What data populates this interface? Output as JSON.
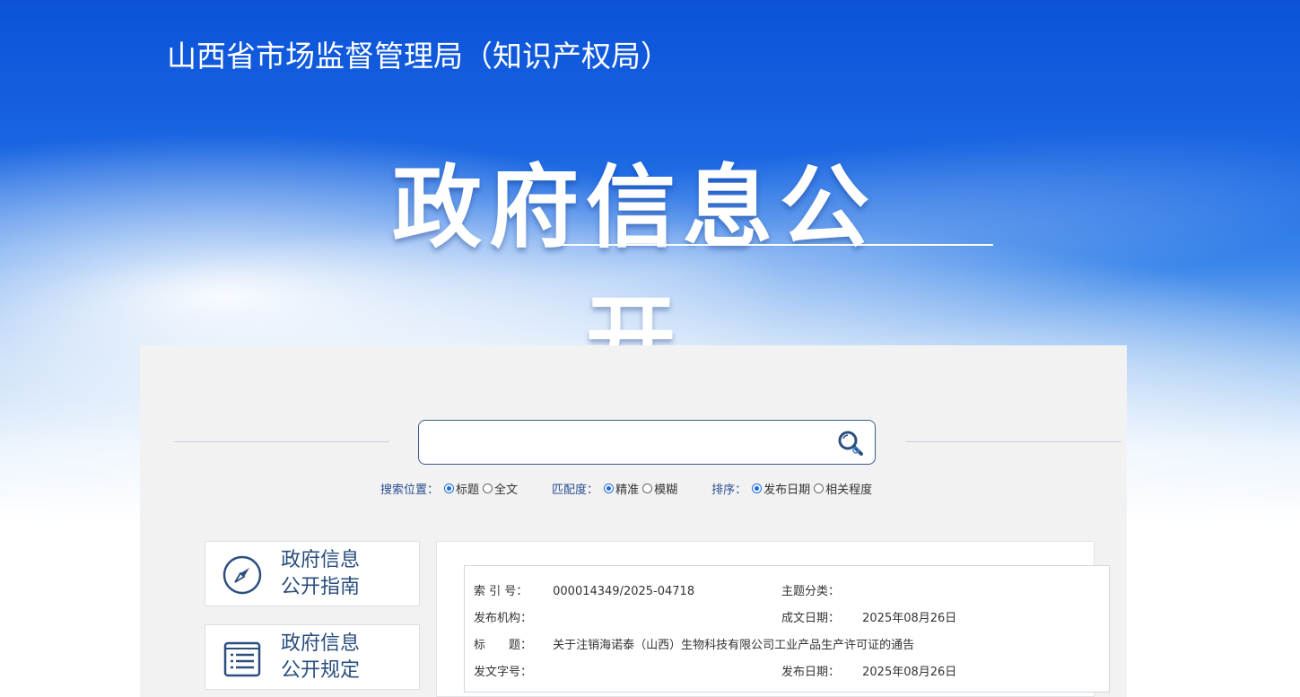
{
  "header": {
    "site_title": "山西省市场监督管理局（知识产权局）",
    "main_title": "政府信息公开"
  },
  "search": {
    "value": "",
    "placeholder": "",
    "position_label": "搜索位置：",
    "position_options": [
      "标题",
      "全文"
    ],
    "position_selected": "标题",
    "match_label": "匹配度：",
    "match_options": [
      "精准",
      "模糊"
    ],
    "match_selected": "精准",
    "sort_label": "排序：",
    "sort_options": [
      "发布日期",
      "相关程度"
    ],
    "sort_selected": "发布日期"
  },
  "sidebar": {
    "items": [
      {
        "label_line1": "政府信息",
        "label_line2": "公开指南",
        "icon": "compass-icon"
      },
      {
        "label_line1": "政府信息",
        "label_line2": "公开规定",
        "icon": "document-list-icon"
      }
    ]
  },
  "document": {
    "index_label": "索 引 号：",
    "index_value": "000014349/2025-04718",
    "topic_label": "主题分类：",
    "topic_value": "",
    "publisher_label": "发布机构：",
    "publisher_value": "",
    "created_label": "成文日期：",
    "created_value": "2025年08月26日",
    "title_label": "标　　题：",
    "title_value": "关于注销海诺泰（山西）生物科技有限公司工业产品生产许可证的通告",
    "docno_label": "发文字号：",
    "docno_value": "",
    "published_label": "发布日期：",
    "published_value": "2025年08月26日"
  },
  "colors": {
    "banner_blue": "#0b52d8",
    "label_blue": "#2a4d8f",
    "card_text": "#2a4e7e",
    "radio_accent": "#1a6ad8"
  }
}
